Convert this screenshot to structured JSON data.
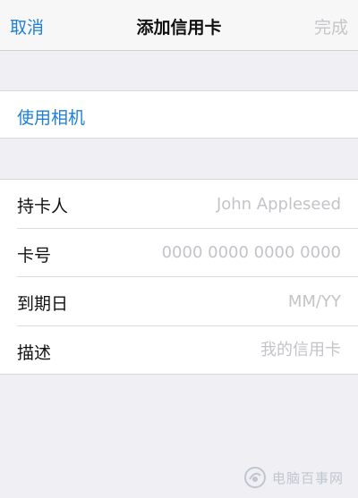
{
  "navbar": {
    "cancel_label": "取消",
    "title": "添加信用卡",
    "done_label": "完成"
  },
  "camera": {
    "label": "使用相机"
  },
  "form": {
    "rows": [
      {
        "label": "持卡人",
        "placeholder": "John Appleseed",
        "value": ""
      },
      {
        "label": "卡号",
        "placeholder": "0000 0000 0000 0000",
        "value": ""
      },
      {
        "label": "到期日",
        "placeholder": "MM/YY",
        "value": ""
      },
      {
        "label": "描述",
        "placeholder": "我的信用卡",
        "value": ""
      }
    ]
  },
  "watermark": {
    "text": "电脑百事网"
  },
  "colors": {
    "accent": "#1d7fd6",
    "disabled": "#c6c6c9",
    "background": "#efeff4",
    "placeholder": "#c4c4c8"
  }
}
